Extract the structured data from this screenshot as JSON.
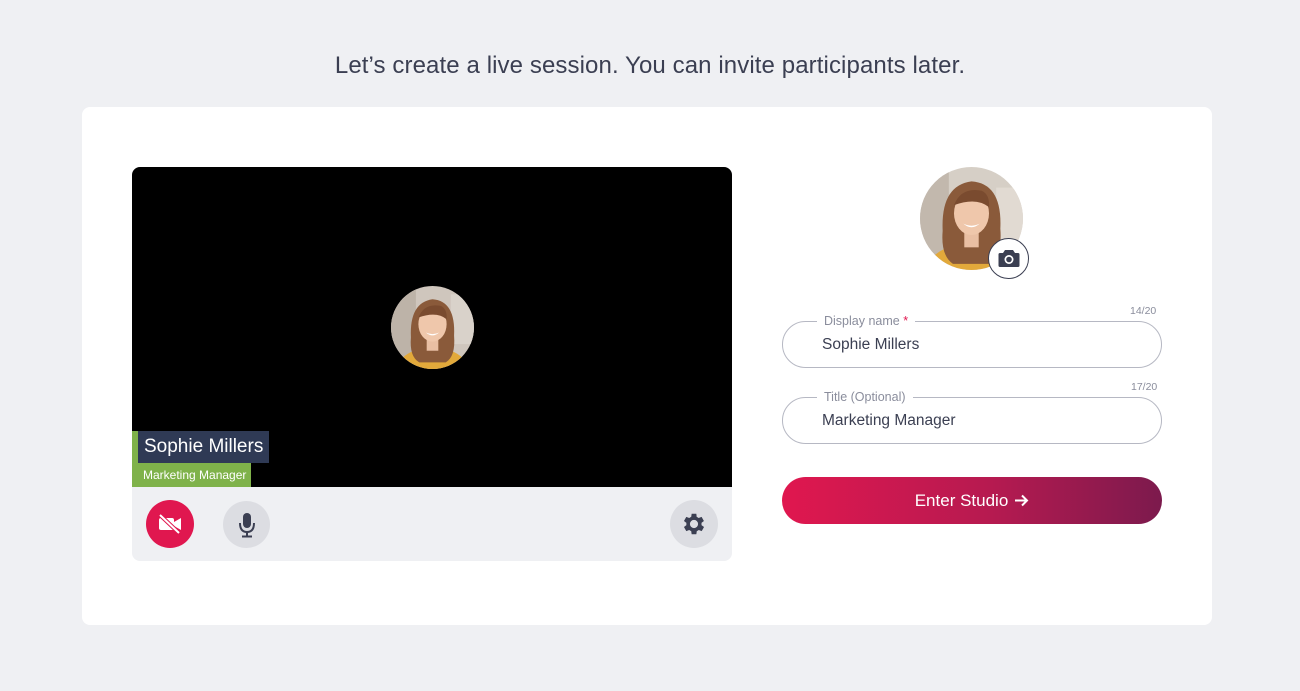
{
  "page": {
    "heading": "Let’s create a live session. You can invite participants later."
  },
  "preview": {
    "name_tag": "Sophie Millers",
    "title_tag": "Marketing Manager",
    "controls": {
      "camera_icon": "video-off-icon",
      "mic_icon": "microphone-icon",
      "settings_icon": "gear-icon"
    }
  },
  "profile": {
    "camera_icon": "camera-icon"
  },
  "form": {
    "display_name": {
      "label": "Display name",
      "required_mark": "*",
      "value": "Sophie Millers",
      "counter": "14/20"
    },
    "title": {
      "label": "Title (Optional)",
      "value": "Marketing Manager",
      "counter": "17/20"
    },
    "enter_button": "Enter Studio"
  },
  "colors": {
    "accent": "#e0174f",
    "accent_dark": "#7c1a4d",
    "name_tag_bg": "#2f3a55",
    "title_tag_bg": "#7fb24a",
    "page_bg": "#eff0f3"
  }
}
